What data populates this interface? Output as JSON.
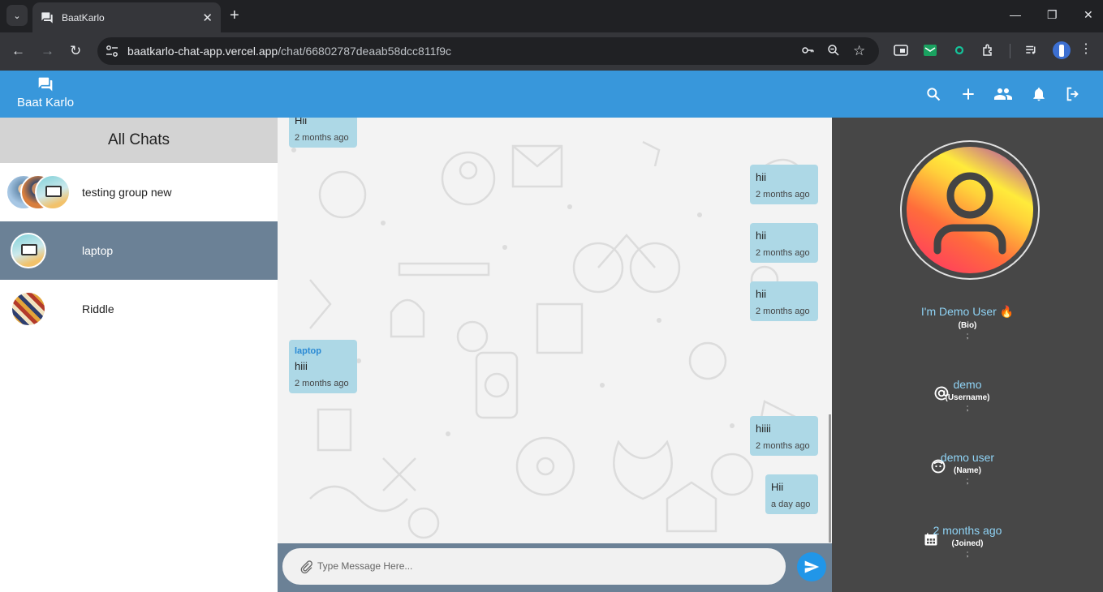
{
  "browser": {
    "tab_title": "BaatKarlo",
    "url_host": "baatkarlo-chat-app.vercel.app",
    "url_path": "/chat/66802787deaab58dcc811f9c"
  },
  "app": {
    "brand": "Baat Karlo",
    "accent_color": "#3897db"
  },
  "sidebar": {
    "title": "All Chats",
    "chats": [
      {
        "name": "testing group new"
      },
      {
        "name": "laptop"
      },
      {
        "name": "Riddle"
      }
    ]
  },
  "messages": [
    {
      "text": "Hii",
      "time": "2 months ago",
      "side": "left"
    },
    {
      "text": "hii",
      "time": "2 months ago",
      "side": "right"
    },
    {
      "text": "hii",
      "time": "2 months ago",
      "side": "right"
    },
    {
      "text": "hii",
      "time": "2 months ago",
      "side": "right"
    },
    {
      "sender": "laptop",
      "text": "hiii",
      "time": "2 months ago",
      "side": "left"
    },
    {
      "text": "hiiii",
      "time": "2 months ago",
      "side": "right"
    },
    {
      "text": "Hii",
      "time": "a day ago",
      "side": "right"
    }
  ],
  "compose": {
    "placeholder": "Type Message Here..."
  },
  "profile": {
    "bio": "I'm Demo User 🔥",
    "bio_label": "(Bio)",
    "username": "demo",
    "username_label": "(Username)",
    "name": "demo user",
    "name_label": "(Name)",
    "joined": "2 months ago",
    "joined_label": "(Joined)",
    "separator": ";"
  }
}
